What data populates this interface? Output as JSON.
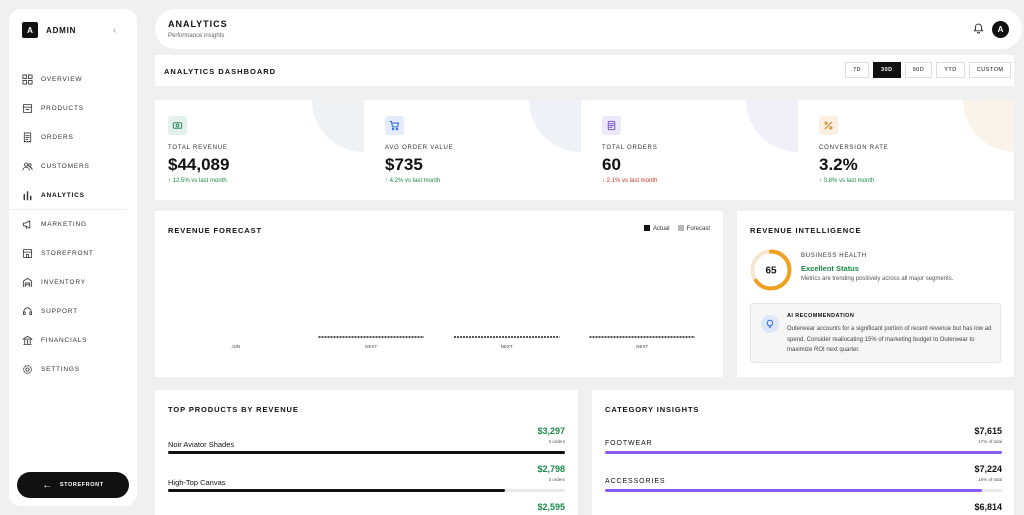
{
  "sidebar": {
    "logo_letter": "A",
    "brand": "ADMIN",
    "items": [
      {
        "label": "OVERVIEW",
        "icon": "grid-icon"
      },
      {
        "label": "PRODUCTS",
        "icon": "box-icon"
      },
      {
        "label": "ORDERS",
        "icon": "receipt-icon"
      },
      {
        "label": "CUSTOMERS",
        "icon": "users-icon"
      },
      {
        "label": "ANALYTICS",
        "icon": "bar-chart-icon",
        "active": true
      },
      {
        "label": "MARKETING",
        "icon": "megaphone-icon"
      },
      {
        "label": "STOREFRONT",
        "icon": "store-icon"
      },
      {
        "label": "INVENTORY",
        "icon": "warehouse-icon"
      },
      {
        "label": "SUPPORT",
        "icon": "headset-icon"
      },
      {
        "label": "FINANCIALS",
        "icon": "bank-icon"
      },
      {
        "label": "SETTINGS",
        "icon": "gear-icon"
      }
    ],
    "storefront_button": "STOREFRONT"
  },
  "header": {
    "title": "ANALYTICS",
    "subtitle": "Performance insights",
    "avatar_letter": "A"
  },
  "dashboard": {
    "title": "ANALYTICS DASHBOARD",
    "ranges": [
      "7D",
      "30D",
      "90D",
      "YTD",
      "CUSTOM"
    ],
    "active_range": "30D"
  },
  "kpis": [
    {
      "label": "TOTAL REVENUE",
      "value": "$44,089",
      "delta": "↑ 12.5% vs last month",
      "trend": "up",
      "icon": "cash-icon",
      "color": "#3a8a6a",
      "bg": "#e3f1ec",
      "deco": "#eef2f4"
    },
    {
      "label": "AVG ORDER VALUE",
      "value": "$735",
      "delta": "↑ 4.2% vs last month",
      "trend": "up",
      "icon": "cart-icon",
      "color": "#3a6fd8",
      "bg": "#e4ecfb",
      "deco": "#eef1f5"
    },
    {
      "label": "TOTAL ORDERS",
      "value": "60",
      "delta": "↓ 2.1% vs last month",
      "trend": "down",
      "icon": "document-icon",
      "color": "#7a5cc8",
      "bg": "#ede8fa",
      "deco": "#f1eff8"
    },
    {
      "label": "CONVERSION RATE",
      "value": "3.2%",
      "delta": "↑ 0.8% vs last month",
      "trend": "up",
      "icon": "percent-icon",
      "color": "#d08a2a",
      "bg": "#fbf0df",
      "deco": "#f9f3ea"
    }
  ],
  "forecast": {
    "title": "REVENUE FORECAST",
    "legend_actual": "Actual",
    "legend_forecast": "Forecast"
  },
  "chart_data": {
    "type": "bar",
    "categories": [
      "JUN",
      "NEXT",
      "NEXT",
      "NEXT"
    ],
    "series": [
      {
        "name": "Actual",
        "values": [
          0,
          null,
          null,
          null
        ],
        "color": "#111111"
      },
      {
        "name": "Forecast",
        "values": [
          null,
          0,
          0,
          0
        ],
        "color": "#bbbbbb"
      }
    ],
    "grid": false,
    "legend": "top-right"
  },
  "intelligence": {
    "title": "REVENUE INTELLIGENCE",
    "score": "65",
    "score_fraction": 0.65,
    "health_label": "BUSINESS HEALTH",
    "status": "Excellent Status",
    "description": "Metrics are trending positively across all major segments.",
    "ai_title": "AI RECOMMENDATION",
    "ai_text": "Outerwear accounts for a significant portion of recent revenue but has low ad spend. Consider reallocating 15% of marketing budget to Outerwear to maximize ROI next quarter."
  },
  "top_products": {
    "title": "TOP PRODUCTS BY REVENUE",
    "items": [
      {
        "name": "Noir Aviator Shades",
        "value": "$3,297",
        "sub": "3 orders",
        "fraction": 1.0
      },
      {
        "name": "High-Top Canvas",
        "value": "$2,798",
        "sub": "3 orders",
        "fraction": 0.85
      },
      {
        "name": "",
        "value": "$2,595",
        "sub": "",
        "fraction": 0.79
      }
    ]
  },
  "categories": {
    "title": "CATEGORY INSIGHTS",
    "items": [
      {
        "name": "FOOTWEAR",
        "value": "$7,615",
        "sub": "17% of total",
        "fraction": 1.0
      },
      {
        "name": "ACCESSORIES",
        "value": "$7,224",
        "sub": "16% of total",
        "fraction": 0.95
      },
      {
        "name": "",
        "value": "$6,814",
        "sub": "",
        "fraction": 0.89
      }
    ]
  }
}
